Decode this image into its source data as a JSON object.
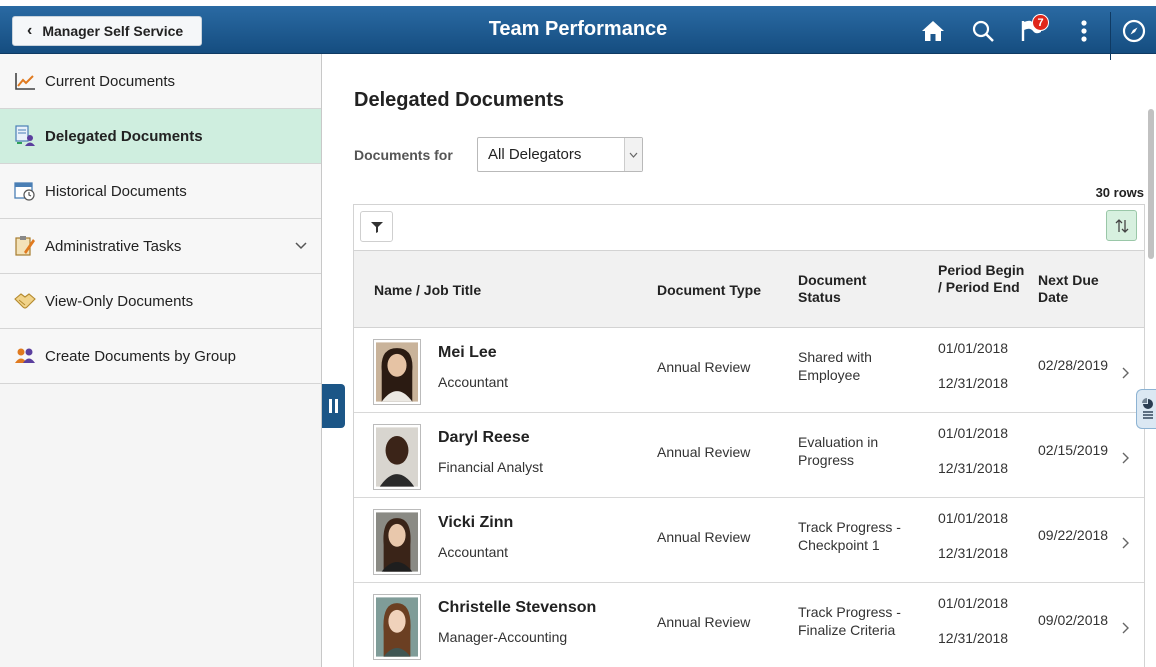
{
  "header": {
    "back_label": "Manager Self Service",
    "title": "Team Performance",
    "notification_count": "7",
    "icons": [
      "home-icon",
      "search-icon",
      "notification-flag-icon",
      "actions-menu-icon",
      "navbar-compass-icon"
    ]
  },
  "sidebar": {
    "items": [
      {
        "label": "Current Documents",
        "icon": "line-chart-icon"
      },
      {
        "label": "Delegated Documents",
        "icon": "delegated-docs-icon",
        "active": true
      },
      {
        "label": "Historical Documents",
        "icon": "calendar-clock-icon"
      },
      {
        "label": "Administrative Tasks",
        "icon": "clipboard-pencil-icon",
        "expandable": true
      },
      {
        "label": "View-Only Documents",
        "icon": "handshake-icon"
      },
      {
        "label": "Create Documents by Group",
        "icon": "group-people-icon"
      }
    ]
  },
  "main": {
    "title": "Delegated Documents",
    "documents_for_label": "Documents for",
    "documents_for_value": "All Delegators",
    "row_count": "30 rows",
    "columns": {
      "name": "Name / Job Title",
      "doc_type": "Document Type",
      "doc_status": "Document Status",
      "period": "Period Begin / Period End",
      "next_due": "Next Due Date"
    },
    "rows": [
      {
        "name": "Mei Lee",
        "job_title": "Accountant",
        "doc_type": "Annual Review",
        "status": "Shared with Employee",
        "period_begin": "01/01/2018",
        "period_end": "12/31/2018",
        "next_due": "02/28/2019"
      },
      {
        "name": "Daryl Reese",
        "job_title": "Financial Analyst",
        "doc_type": "Annual Review",
        "status": "Evaluation in Progress",
        "period_begin": "01/01/2018",
        "period_end": "12/31/2018",
        "next_due": "02/15/2019"
      },
      {
        "name": "Vicki Zinn",
        "job_title": "Accountant",
        "doc_type": "Annual Review",
        "status": "Track Progress - Checkpoint 1",
        "period_begin": "01/01/2018",
        "period_end": "12/31/2018",
        "next_due": "09/22/2018"
      },
      {
        "name": "Christelle Stevenson",
        "job_title": "Manager-Accounting",
        "doc_type": "Annual Review",
        "status": "Track Progress - Finalize Criteria",
        "period_begin": "01/01/2018",
        "period_end": "12/31/2018",
        "next_due": "09/02/2018"
      }
    ]
  },
  "colors": {
    "banner": "#1f5f96",
    "active_item": "#cfeedf",
    "badge": "#e0261b",
    "sort_button": "#d7f0df"
  }
}
